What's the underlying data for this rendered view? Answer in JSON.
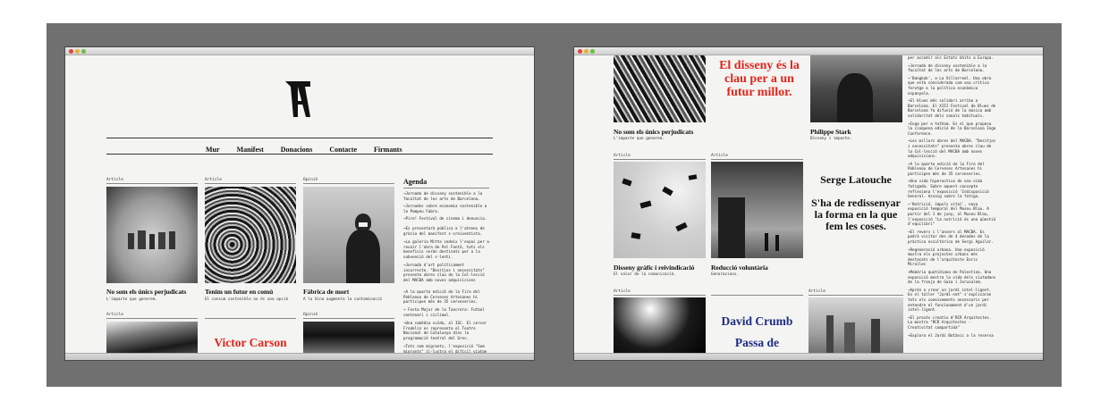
{
  "left": {
    "nav": [
      "Mur",
      "Manifest",
      "Donacions",
      "Contacte",
      "Firmants"
    ],
    "cards": [
      {
        "tag": "Article",
        "title": "No som els únics perjudicats",
        "sub": "L'impacte que generem."
      },
      {
        "tag": "Article",
        "title": "Tenim un futur en comú",
        "sub": "El consum sostenible no és una opció"
      },
      {
        "tag": "Opinió",
        "title": "Fàbrica de mort",
        "sub": "A la Xina augmenta la contaminació"
      },
      {
        "tag": "Article"
      },
      {
        "tag": "Article",
        "title": "Victor Carson"
      },
      {
        "tag": "Opinió"
      }
    ],
    "agenda": {
      "title": "Agenda",
      "items": [
        "→Jornada de disseny sostenible a la facultat de les arts de Barcelona.",
        "→Jornades sobre economia sostenible a la Pompeu Fabra.",
        "→Pire! Festival de cinema i denuncia.",
        "→Es presentarà pùblica a l'ateneu de gràcia del manifest s-creixentista.",
        "→La galería Mitte cedeix l'espai per a reunir l'obra de Pol Fontó, tots els beneficis seràn destinats per a la subvenció del s-lenti.",
        "→Jornada d'art políticament incorrecte. \"Desitjos i necessitats\" presenta obres clau de la Col·lecció del MACBA amb noves adquisicions",
        "→A la quarta edició de la Fira del Poblenou de Cerveses Artesanes hi participen més de 35 cerveseries.",
        "→ Festa Major de la Tancrera: Futbol centenari i ciclimol.",
        "→Una comèdia suïda, al ISC. El cercer Franklin es representa el Teatre Nacional de Catalunya dins la programació teatral del Grec.",
        "→Tots som migrants, l'exposició \"Som migrants\" il·lustra el difícil viatge"
      ]
    }
  },
  "right": {
    "quote_red": "El disseny és la clau per a un futur millor.",
    "cards": [
      {
        "title": "No som els únics perjudicats",
        "sub": "L'impacte que generem."
      },
      {
        "title": "Philippe Stark",
        "sub": "Disseny i impacte."
      },
      {
        "tag": "Article",
        "title": "Disseny gràfic i reivindicació",
        "sub": "El valor de la comunicació."
      },
      {
        "tag": "Article",
        "title": "Reducció voluntària",
        "sub": "Generacions."
      },
      {
        "tag": "Article"
      },
      {
        "tag": "Article"
      }
    ],
    "latouche_name": "Serge Latouche",
    "latouche_quote": "S'ha de redissenyar la forma en la que fem les coses.",
    "crumb_name": "David Crumb",
    "crumb_quote": "Passa de",
    "feed": [
      "per accedir als Estats Units a Europa.",
      "→Jornada de disseny sostenible a la facultat de les arts de Barcelona.",
      "→'Bangkok', a La Villarroel. Una obra que està considerada com una crítica ferotge a la política econòmica espanyola.",
      "→El blues més solidari arriba a Barcelona. El XIII Festival de Blues de Barcelona fa difusió de la música amb solidaritat dels canals habituals.",
      "→Inga per a tothom. Es el que proposa la cinquena edició de la Barcelona Inga Conference.",
      "→Les millors obres del MACBA. \"Desitjos i necessitats\" presenta obres clau de la Col·lecció del MACBA amb noves adquisicions.",
      "→A la quarta edició de la Fira del Poblenou de Cerveses Artesanes hi participen més de 35 cerveseries.",
      "→Una vida hiperactiva de una vida fatigada. Sobre aquest concepte reflexiona l'exposició 'Indisposició General. Assaig sobre la fatiga.",
      "→'Nutrició, impuls vital', nova exposició temporal del Museu Blau. A partir del 1 de juny, al Museu Blau, l'exposició \"La nutrició és una qüestió d'equilibri\"",
      "→El revers i l'anvers al MACBA. Es podrà visitar des de 4 decades de la pràctica escultòrica de Sergi Aguilar.",
      "→Regeneració urbana. Una exposició mostra els projectes urbans més destacats de l'arquitecte Enric Miralles",
      "→Memòria quotidiana de Palestina. Una exposició mostra la vida dels ciutadans de la franja de Gaza i Jerusalem.",
      "→Aprèn a crear un jardí intel·ligent. En el taller \"Jardí-net\" s'explicaran tots els coneixements necessaris per entendre el funcionament d'un jardí intel·ligent.",
      "→El procés creatiu d'RCR Arquitectes. La mostra \"RCR Arquitectes - Creativitat compartida\"",
      "→Explora el Jardí Botànic a la reserva"
    ]
  }
}
